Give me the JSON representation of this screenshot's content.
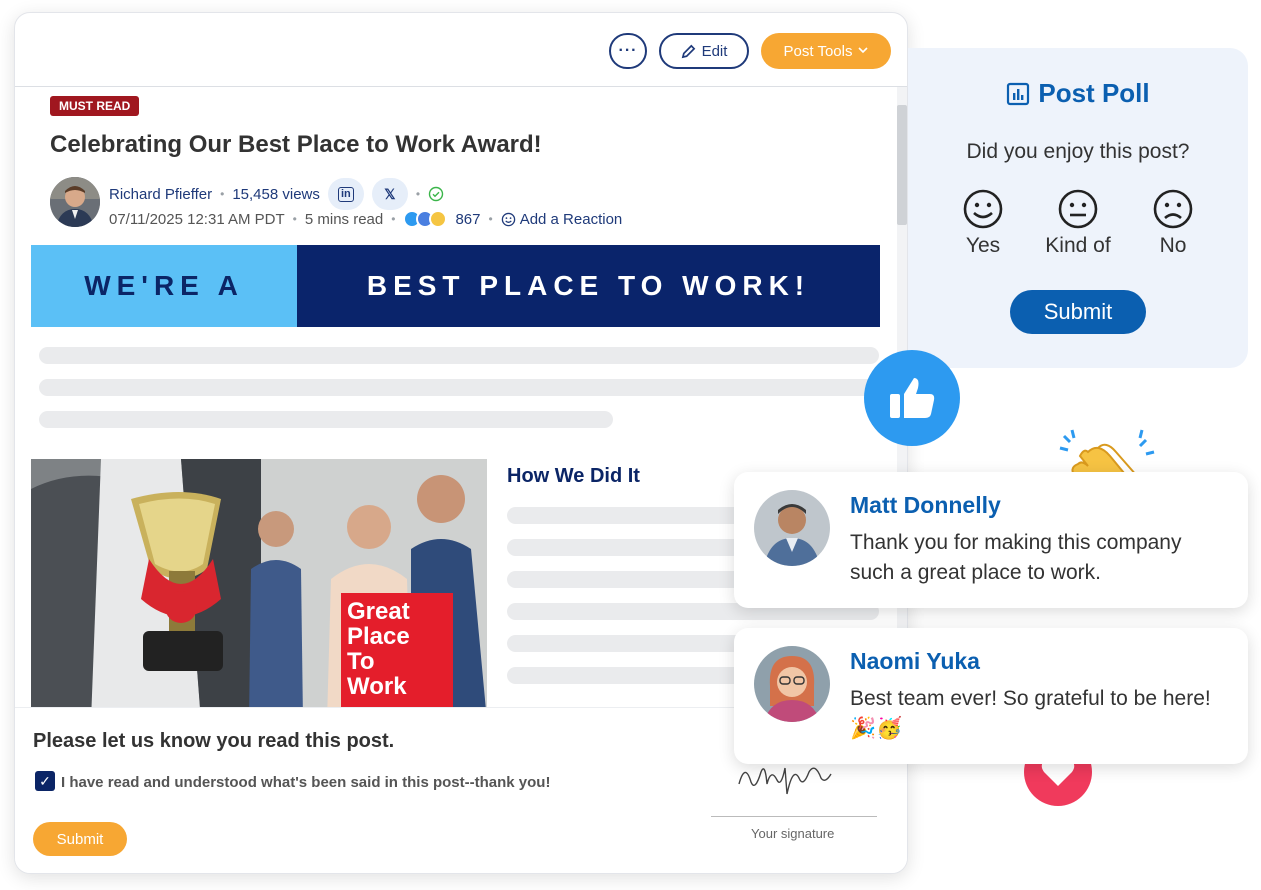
{
  "toolbar": {
    "more_label": "···",
    "edit_label": "Edit",
    "tools_label": "Post Tools"
  },
  "post": {
    "badge": "MUST READ",
    "title": "Celebrating Our Best Place to Work Award!",
    "author": "Richard Pfieffer",
    "views": "15,458 views",
    "share_linkedin": "in",
    "share_x": "𝕏",
    "date": "07/11/2025 12:31 AM PDT",
    "read_time": "5 mins read",
    "reaction_count": "867",
    "add_reaction": "Add a Reaction",
    "banner_left": "WE'RE A",
    "banner_right": "BEST PLACE TO WORK!",
    "subheading": "How We Did It",
    "award_logo_text": [
      "Great",
      "Place",
      "To",
      "Work"
    ]
  },
  "confirm": {
    "title": "Please let us know you read this post.",
    "checkbox_label": "I have read and understood what's been said in this post--thank you!",
    "checked": true,
    "submit_label": "Submit",
    "signature_label": "Your signature"
  },
  "poll": {
    "title": "Post Poll",
    "question": "Did you enjoy this post?",
    "options": [
      "Yes",
      "Kind of",
      "No"
    ],
    "submit_label": "Submit"
  },
  "comments": [
    {
      "name": "Matt Donnelly",
      "text": "Thank you for making this company such a great place to work."
    },
    {
      "name": "Naomi Yuka",
      "text": "Best team ever! So grateful to be here! 🎉🥳"
    }
  ],
  "colors": {
    "accent_orange": "#f7a733",
    "navy": "#0b2566",
    "poll_blue": "#0b5fb0",
    "badge_red": "#a0171f",
    "like_blue": "#2d9af0",
    "heart_red": "#f03a5c"
  }
}
